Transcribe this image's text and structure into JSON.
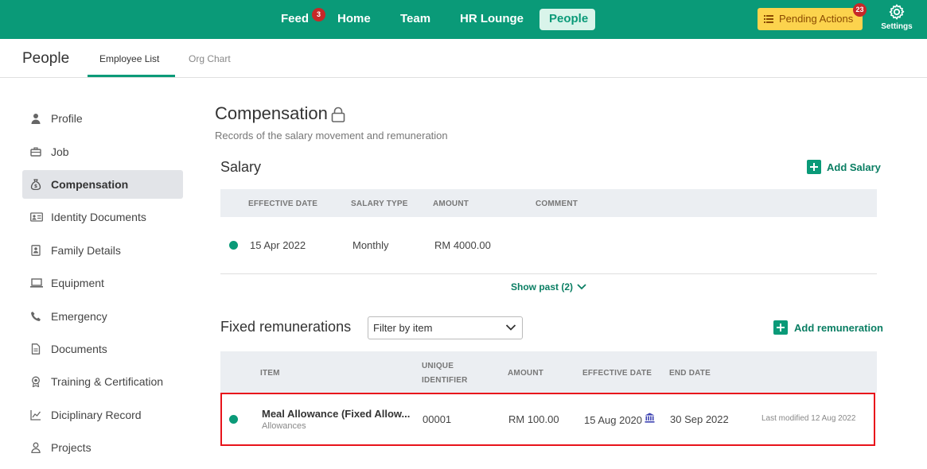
{
  "topnav": {
    "items": [
      {
        "label": "Feed",
        "badge": "3"
      },
      {
        "label": "Home"
      },
      {
        "label": "Team"
      },
      {
        "label": "HR Lounge"
      },
      {
        "label": "People"
      }
    ],
    "pending": {
      "label": "Pending Actions",
      "badge": "23"
    },
    "settings_label": "Settings"
  },
  "subheader": {
    "title": "People",
    "tabs": [
      "Employee List",
      "Org Chart"
    ]
  },
  "sidebar": {
    "items": [
      {
        "label": "Profile",
        "icon": "person-icon"
      },
      {
        "label": "Job",
        "icon": "briefcase-icon"
      },
      {
        "label": "Compensation",
        "icon": "money-bag-icon"
      },
      {
        "label": "Identity Documents",
        "icon": "id-card-icon"
      },
      {
        "label": "Family Details",
        "icon": "family-icon"
      },
      {
        "label": "Equipment",
        "icon": "laptop-icon"
      },
      {
        "label": "Emergency",
        "icon": "phone-icon"
      },
      {
        "label": "Documents",
        "icon": "document-icon"
      },
      {
        "label": "Training & Certification",
        "icon": "certificate-icon"
      },
      {
        "label": "Diciplinary Record",
        "icon": "chart-icon"
      },
      {
        "label": "Projects",
        "icon": "projects-icon"
      }
    ]
  },
  "compensation": {
    "title": "Compensation",
    "subtitle": "Records of the salary movement and remuneration"
  },
  "salary": {
    "title": "Salary",
    "add_label": "Add Salary",
    "columns": [
      "EFFECTIVE DATE",
      "SALARY TYPE",
      "AMOUNT",
      "COMMENT"
    ],
    "rows": [
      {
        "effective_date": "15 Apr 2022",
        "salary_type": "Monthly",
        "amount": "RM 4000.00",
        "comment": ""
      }
    ],
    "show_past": "Show past (2)"
  },
  "remunerations": {
    "title": "Fixed remunerations",
    "filter_placeholder": "Filter by item",
    "add_label": "Add remuneration",
    "columns": {
      "item": "ITEM",
      "unique_identifier_line1": "UNIQUE",
      "unique_identifier_line2": "IDENTIFIER",
      "amount": "AMOUNT",
      "effective_date": "EFFECTIVE DATE",
      "end_date": "END DATE"
    },
    "rows": [
      {
        "item": "Meal Allowance (Fixed Allow...",
        "category": "Allowances",
        "unique_identifier": "00001",
        "amount": "RM 100.00",
        "effective_date": "15 Aug 2020",
        "end_date": "30 Sep 2022",
        "last_modified": "Last modified 12 Aug 2022"
      }
    ]
  },
  "colors": {
    "brand": "#0a9a78",
    "highlight": "#e8131b",
    "pending": "#fcd34d",
    "badge": "#c62828"
  }
}
